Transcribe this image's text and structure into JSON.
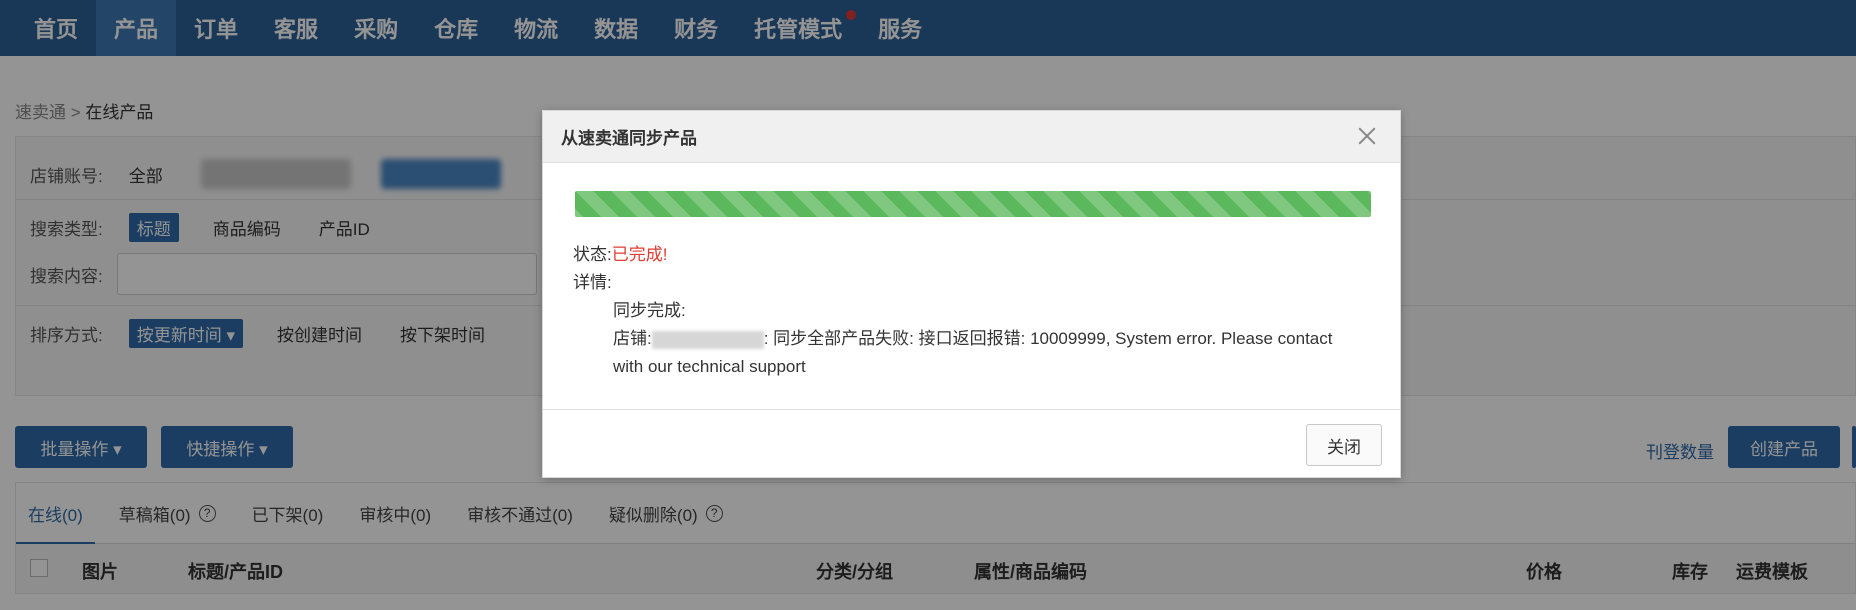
{
  "nav": {
    "items": [
      "首页",
      "产品",
      "订单",
      "客服",
      "采购",
      "仓库",
      "物流",
      "数据",
      "财务",
      "托管模式",
      "服务"
    ],
    "active_index": 1
  },
  "breadcrumb": {
    "parent": "速卖通",
    "separator": ">",
    "current": "在线产品"
  },
  "filters": {
    "shop_label": "店铺账号:",
    "shop_all": "全部",
    "search_type_label": "搜索类型:",
    "search_types": [
      "标题",
      "商品编码",
      "产品ID"
    ],
    "search_content_label": "搜索内容:",
    "sort_label": "排序方式:",
    "sort_options": [
      "按更新时间 ▾",
      "按创建时间",
      "按下架时间"
    ]
  },
  "actions": {
    "batch": "批量操作 ▾",
    "quick": "快捷操作 ▾",
    "listing_count": "刊登数量",
    "create": "创建产品"
  },
  "tabs": [
    "在线(0)",
    "草稿箱(0)",
    "已下架(0)",
    "审核中(0)",
    "审核不通过(0)",
    "疑似删除(0)"
  ],
  "table_headers": [
    "图片",
    "标题/产品ID",
    "分类/分组",
    "属性/商品编码",
    "价格",
    "库存",
    "运费模板"
  ],
  "modal": {
    "title": "从速卖通同步产品",
    "progress_percent": 100,
    "status_label": "状态:",
    "status_value": "已完成!",
    "detail_label": "详情:",
    "sync_done": "同步完成:",
    "shop_prefix": "店铺:",
    "error_text": ": 同步全部产品失败: 接口返回报错: 10009999, System error. Please contact",
    "error_text_2": "with our technical support",
    "close_button": "关闭"
  },
  "colors": {
    "nav_bg": "#2b5f94",
    "accent": "#2d6aa7",
    "progress": "#5cb85c",
    "status": "#e03c31"
  }
}
